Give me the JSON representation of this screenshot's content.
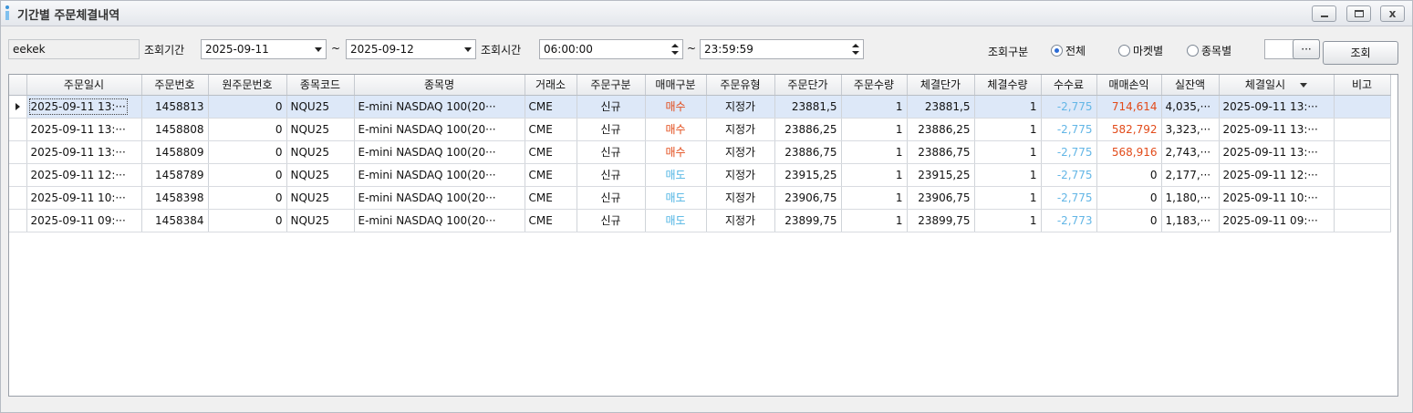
{
  "window": {
    "title": "기간별 주문체결내역",
    "controls": {
      "minimize": "_",
      "maximize": "□",
      "close": "x"
    }
  },
  "toolbar": {
    "account_value": "eekek",
    "period_label": "조회기간",
    "date_from": "2025-09-11",
    "range_sep_1": "~",
    "date_to": "2025-09-12",
    "time_label": "조회시간",
    "time_from": "06:00:00",
    "range_sep_2": "~",
    "time_to": "23:59:59",
    "filter_label": "조회구분",
    "filter_options": [
      {
        "label": "전체",
        "selected": true
      },
      {
        "label": "마켓별",
        "selected": false
      },
      {
        "label": "종목별",
        "selected": false
      }
    ],
    "symbol_value": "",
    "ellipsis_label": "···",
    "search_label": "조회"
  },
  "table": {
    "columns": [
      "주문일시",
      "주문번호",
      "원주문번호",
      "종목코드",
      "종목명",
      "거래소",
      "주문구분",
      "매매구분",
      "주문유형",
      "주문단가",
      "주문수량",
      "체결단가",
      "체결수량",
      "수수료",
      "매매손익",
      "실잔액",
      "체결일시",
      "비고"
    ],
    "rows": [
      {
        "order_time": "2025-09-11 13:···",
        "order_no": "1458813",
        "orig_order_no": "0",
        "code": "NQU25",
        "name": "E-mini NASDAQ 100(20···",
        "exchange": "CME",
        "order_kind": "신규",
        "side": "매수",
        "side_type": "buy",
        "order_type": "지정가",
        "order_price": "23881,5",
        "order_qty": "1",
        "fill_price": "23881,5",
        "fill_qty": "1",
        "fee": "-2,775",
        "pnl": "714,614",
        "balance": "4,035,···",
        "fill_time": "2025-09-11 13:···",
        "note": ""
      },
      {
        "order_time": "2025-09-11 13:···",
        "order_no": "1458808",
        "orig_order_no": "0",
        "code": "NQU25",
        "name": "E-mini NASDAQ 100(20···",
        "exchange": "CME",
        "order_kind": "신규",
        "side": "매수",
        "side_type": "buy",
        "order_type": "지정가",
        "order_price": "23886,25",
        "order_qty": "1",
        "fill_price": "23886,25",
        "fill_qty": "1",
        "fee": "-2,775",
        "pnl": "582,792",
        "balance": "3,323,···",
        "fill_time": "2025-09-11 13:···",
        "note": ""
      },
      {
        "order_time": "2025-09-11 13:···",
        "order_no": "1458809",
        "orig_order_no": "0",
        "code": "NQU25",
        "name": "E-mini NASDAQ 100(20···",
        "exchange": "CME",
        "order_kind": "신규",
        "side": "매수",
        "side_type": "buy",
        "order_type": "지정가",
        "order_price": "23886,75",
        "order_qty": "1",
        "fill_price": "23886,75",
        "fill_qty": "1",
        "fee": "-2,775",
        "pnl": "568,916",
        "balance": "2,743,···",
        "fill_time": "2025-09-11 13:···",
        "note": ""
      },
      {
        "order_time": "2025-09-11 12:···",
        "order_no": "1458789",
        "orig_order_no": "0",
        "code": "NQU25",
        "name": "E-mini NASDAQ 100(20···",
        "exchange": "CME",
        "order_kind": "신규",
        "side": "매도",
        "side_type": "sell",
        "order_type": "지정가",
        "order_price": "23915,25",
        "order_qty": "1",
        "fill_price": "23915,25",
        "fill_qty": "1",
        "fee": "-2,775",
        "pnl": "0",
        "balance": "2,177,···",
        "fill_time": "2025-09-11 12:···",
        "note": ""
      },
      {
        "order_time": "2025-09-11 10:···",
        "order_no": "1458398",
        "orig_order_no": "0",
        "code": "NQU25",
        "name": "E-mini NASDAQ 100(20···",
        "exchange": "CME",
        "order_kind": "신규",
        "side": "매도",
        "side_type": "sell",
        "order_type": "지정가",
        "order_price": "23906,75",
        "order_qty": "1",
        "fill_price": "23906,75",
        "fill_qty": "1",
        "fee": "-2,775",
        "pnl": "0",
        "balance": "1,180,···",
        "fill_time": "2025-09-11 10:···",
        "note": ""
      },
      {
        "order_time": "2025-09-11 09:···",
        "order_no": "1458384",
        "orig_order_no": "0",
        "code": "NQU25",
        "name": "E-mini NASDAQ 100(20···",
        "exchange": "CME",
        "order_kind": "신규",
        "side": "매도",
        "side_type": "sell",
        "order_type": "지정가",
        "order_price": "23899,75",
        "order_qty": "1",
        "fill_price": "23899,75",
        "fill_qty": "1",
        "fee": "-2,773",
        "pnl": "0",
        "balance": "1,183,···",
        "fill_time": "2025-09-11 09:···",
        "note": ""
      }
    ]
  },
  "colors": {
    "buy": "#e24b1a",
    "sell": "#4fb4e3",
    "fee": "#63b6e6",
    "selected_row": "#dde8f8"
  },
  "icons": {
    "window": "app-icon",
    "row_pointer": "caret-right-icon",
    "sort": "sort-down-icon"
  }
}
